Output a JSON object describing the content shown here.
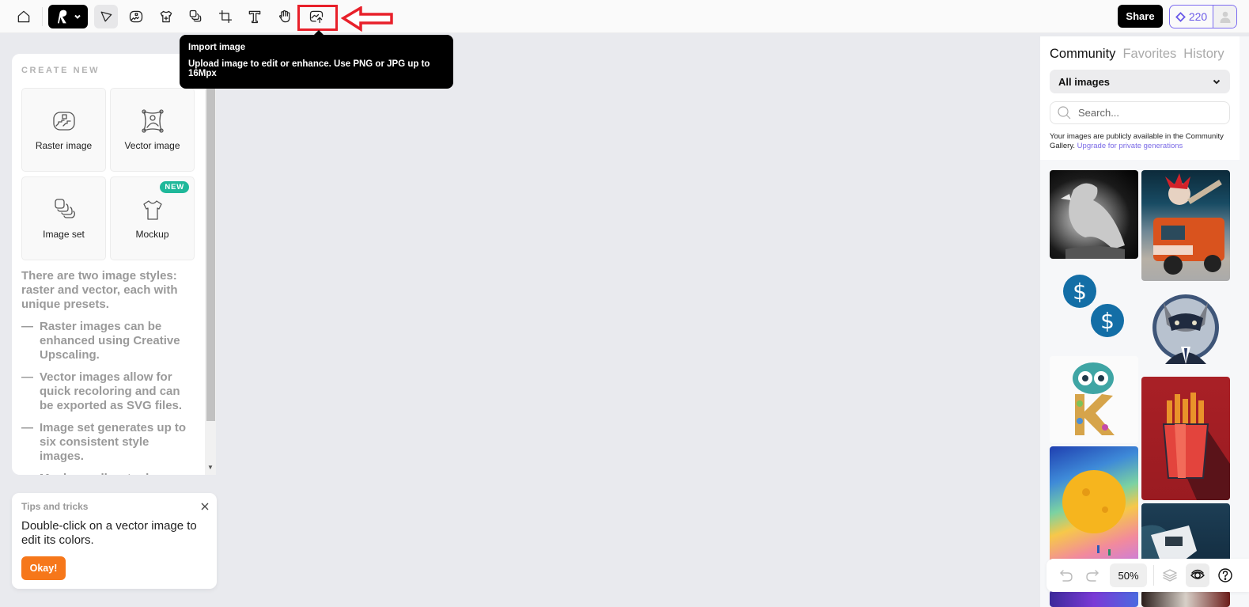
{
  "toolbar": {
    "home_icon": "home-icon",
    "logo_icon": "logo-icon",
    "tools": [
      {
        "name": "select-tool",
        "icon": "pointer-icon",
        "active": true
      },
      {
        "name": "raster-tool",
        "icon": "raster-image-icon"
      },
      {
        "name": "mockup-tool",
        "icon": "tshirt-icon"
      },
      {
        "name": "image-set-tool",
        "icon": "image-set-icon"
      },
      {
        "name": "crop-tool",
        "icon": "crop-icon"
      },
      {
        "name": "text-tool",
        "icon": "text-icon"
      },
      {
        "name": "hand-tool",
        "icon": "hand-icon"
      },
      {
        "name": "import-tool",
        "icon": "import-image-icon",
        "highlighted": true
      }
    ],
    "share_label": "Share",
    "credits": "220",
    "accent": "#6a5ae8"
  },
  "tooltip": {
    "title": "Import image",
    "body": "Upload image to edit or enhance. Use PNG or JPG up to 16Mpx"
  },
  "create_new": {
    "heading": "CREATE NEW",
    "cards": [
      {
        "label": "Raster image",
        "icon": "raster-image-icon"
      },
      {
        "label": "Vector image",
        "icon": "vector-image-icon"
      },
      {
        "label": "Image set",
        "icon": "image-set-icon"
      },
      {
        "label": "Mockup",
        "icon": "tshirt-icon",
        "badge": "NEW"
      }
    ],
    "intro": "There are two image styles: raster and vector, each with unique presets.",
    "bullets": [
      "Raster images can be enhanced using Creative Upscaling.",
      "Vector images allow for quick recoloring and can be exported as SVG files.",
      "Image set generates up to six consistent style images.",
      "Mockups allow to drag an"
    ],
    "dash": "—"
  },
  "tips": {
    "title": "Tips and tricks",
    "body": "Double-click on a vector image to edit its colors.",
    "button": "Okay!",
    "button_color": "#f6771a"
  },
  "gallery": {
    "tabs": [
      "Community",
      "Favorites",
      "History"
    ],
    "active_tab": "Community",
    "filter": "All images",
    "search_placeholder": "Search...",
    "note": "Your images are publicly available in the Community Gallery.",
    "upgrade_link": "Upgrade for private generations",
    "images": [
      {
        "name": "eagle-engraving"
      },
      {
        "name": "clown-fire-truck"
      },
      {
        "name": "dollar-coins"
      },
      {
        "name": "raccoon-mascot"
      },
      {
        "name": "monster-letter-k"
      },
      {
        "name": "french-fries"
      },
      {
        "name": "watercolor-planet"
      },
      {
        "name": "yacht"
      },
      {
        "name": "galaxy-partial"
      },
      {
        "name": "dark-partial"
      }
    ]
  },
  "zoombar": {
    "zoom": "50%"
  }
}
